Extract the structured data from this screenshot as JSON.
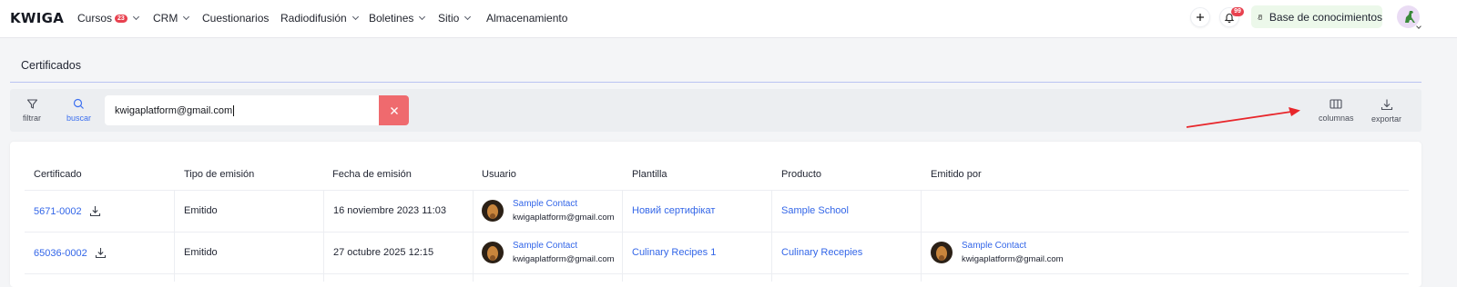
{
  "brand": "KWIGA",
  "nav": {
    "items": [
      {
        "label": "Cursos",
        "badge": "23",
        "dropdown": true
      },
      {
        "label": "CRM",
        "dropdown": true
      },
      {
        "label": "Cuestionarios",
        "dropdown": false
      },
      {
        "label": "Radiodifusión",
        "dropdown": true
      },
      {
        "label": "Boletines",
        "dropdown": true
      },
      {
        "label": "Sitio",
        "dropdown": true
      },
      {
        "label": "Almacenamiento",
        "dropdown": false
      }
    ],
    "notifications_badge": "99",
    "knowledge_base_label": "Base de conocimientos"
  },
  "page": {
    "title": "Certificados"
  },
  "toolbar": {
    "filter_label": "filtrar",
    "search_label": "buscar",
    "search_value": "kwigaplatform@gmail.com",
    "columns_label": "columnas",
    "export_label": "exportar"
  },
  "table": {
    "headers": [
      "Certificado",
      "Tipo de emisión",
      "Fecha de emisión",
      "Usuario",
      "Plantilla",
      "Producto",
      "Emitido por"
    ],
    "rows": [
      {
        "certificate": "5671-0002",
        "type": "Emitido",
        "date": "16 noviembre 2023 11:03",
        "user_name": "Sample Contact",
        "user_email": "kwigaplatform@gmail.com",
        "template": "Новий сертифікат",
        "product": "Sample School",
        "issued_by_name": "",
        "issued_by_email": ""
      },
      {
        "certificate": "65036-0002",
        "type": "Emitido",
        "date": "27 octubre 2025 12:15",
        "user_name": "Sample Contact",
        "user_email": "kwigaplatform@gmail.com",
        "template": "Culinary Recipes 1",
        "product": "Culinary Recepies",
        "issued_by_name": "Sample Contact",
        "issued_by_email": "kwigaplatform@gmail.com"
      }
    ]
  },
  "colors": {
    "accent": "#3366e8",
    "danger": "#ef6a6e",
    "badge": "#e8414f",
    "annotation_arrow": "#e8262b"
  }
}
